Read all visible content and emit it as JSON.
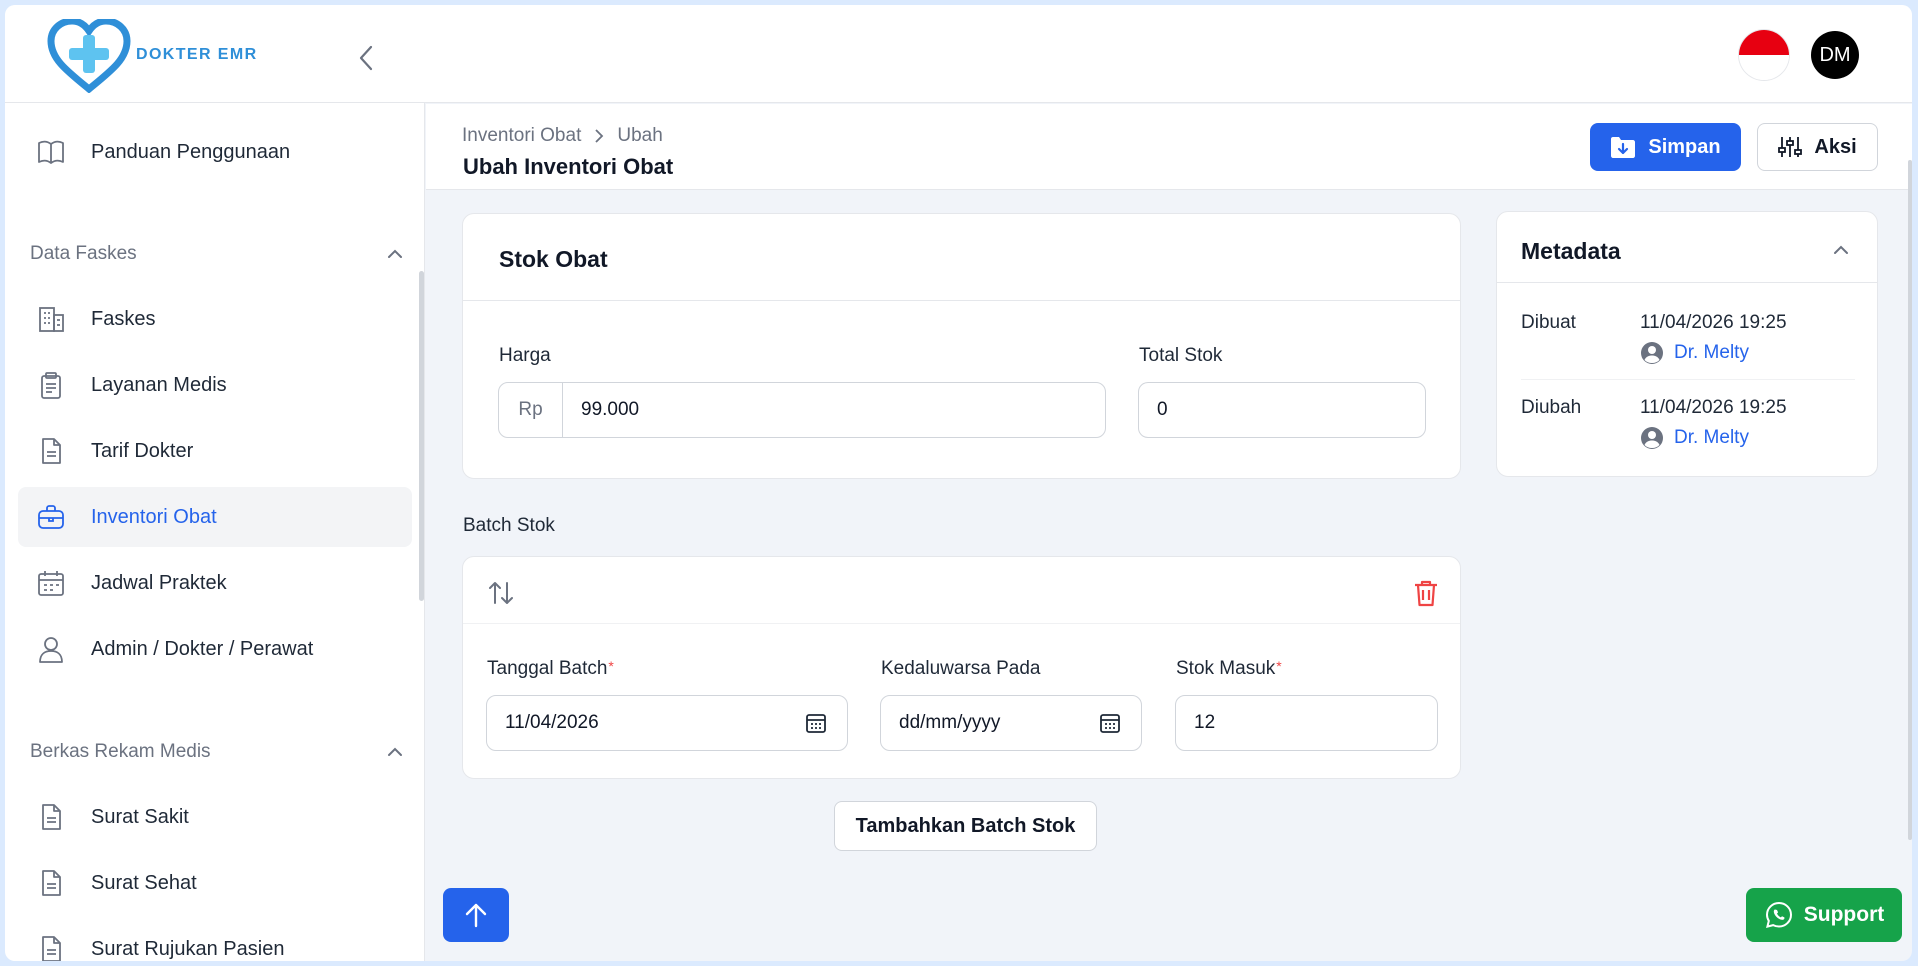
{
  "app": {
    "logo_text": "DOKTER EMR"
  },
  "header": {
    "avatar_initials": "DM",
    "language_flag": "Indonesia"
  },
  "sidebar": {
    "top_items": [
      {
        "label": "Panduan Penggunaan",
        "icon": "book-icon"
      }
    ],
    "sections": [
      {
        "title": "Data Faskes",
        "items": [
          {
            "label": "Faskes",
            "icon": "building-icon"
          },
          {
            "label": "Layanan Medis",
            "icon": "clipboard-icon"
          },
          {
            "label": "Tarif Dokter",
            "icon": "document-icon"
          },
          {
            "label": "Inventori Obat",
            "icon": "briefcase-icon",
            "active": true
          },
          {
            "label": "Jadwal Praktek",
            "icon": "calendar-icon"
          },
          {
            "label": "Admin / Dokter / Perawat",
            "icon": "user-icon"
          }
        ]
      },
      {
        "title": "Berkas Rekam Medis",
        "items": [
          {
            "label": "Surat Sakit",
            "icon": "document-icon"
          },
          {
            "label": "Surat Sehat",
            "icon": "document-icon"
          },
          {
            "label": "Surat Rujukan Pasien",
            "icon": "document-icon"
          }
        ]
      }
    ]
  },
  "page": {
    "breadcrumb": [
      "Inventori Obat",
      "Ubah"
    ],
    "title": "Ubah Inventori Obat",
    "save_label": "Simpan",
    "actions_label": "Aksi"
  },
  "stok_obat": {
    "title": "Stok Obat",
    "harga_label": "Harga",
    "harga_prefix": "Rp",
    "harga_value": "99.000",
    "total_stok_label": "Total Stok",
    "total_stok_value": "0"
  },
  "batch": {
    "section_label": "Batch Stok",
    "tanggal_label": "Tanggal Batch",
    "tanggal_value": "11/04/2026",
    "kedaluwarsa_label": "Kedaluwarsa Pada",
    "kedaluwarsa_placeholder": "dd/mm/yyyy",
    "stok_masuk_label": "Stok Masuk",
    "stok_masuk_value": "12",
    "required_mark": "*",
    "add_label": "Tambahkan Batch Stok"
  },
  "metadata": {
    "title": "Metadata",
    "created_label": "Dibuat",
    "created_date": "11/04/2026 19:25",
    "created_by": "Dr. Melty",
    "updated_label": "Diubah",
    "updated_date": "11/04/2026 19:25",
    "updated_by": "Dr. Melty"
  },
  "floating": {
    "support_label": "Support"
  },
  "colors": {
    "primary": "#2563eb",
    "danger": "#ef4444",
    "whatsapp": "#16a34a",
    "logo": "#2f8fd8"
  }
}
